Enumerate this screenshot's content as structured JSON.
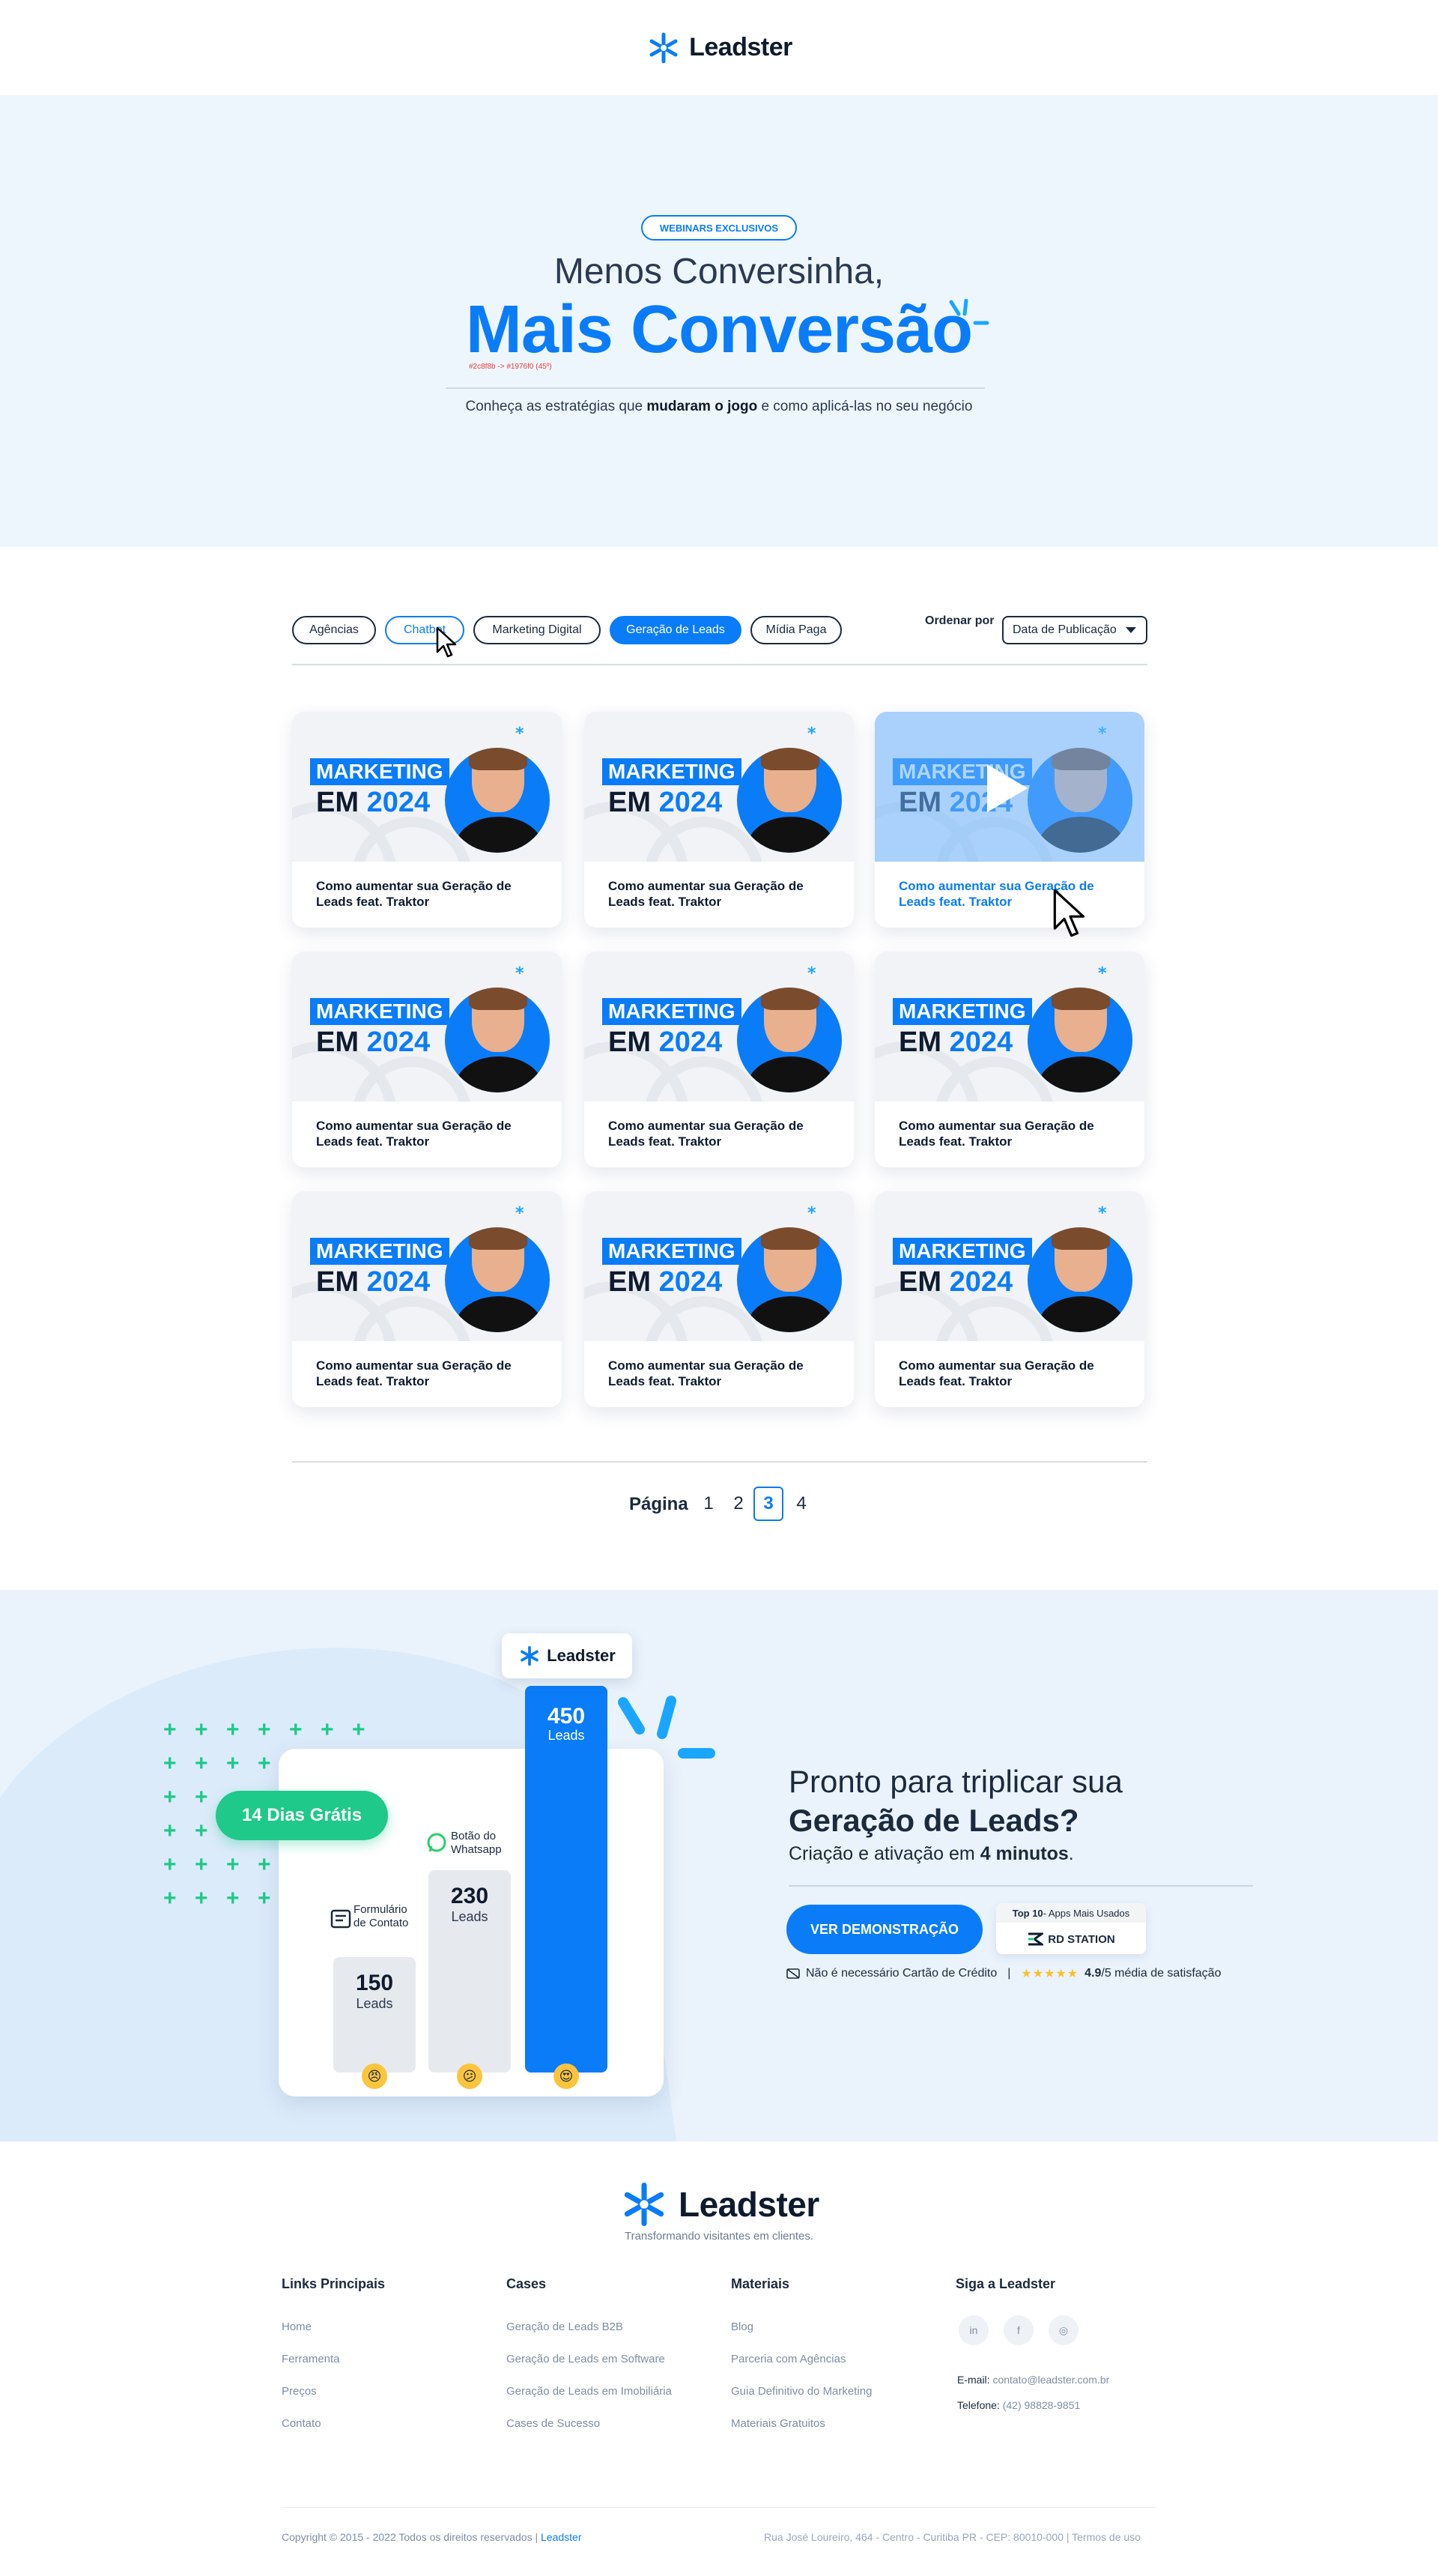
{
  "header": {
    "logo_text": "Leadster"
  },
  "hero": {
    "badge": "WEBINARS EXCLUSIVOS",
    "line1": "Menos Conversinha,",
    "line2": "Mais Conversão",
    "tiny_note": "#2c8f8b -> #1976f0 (45º)",
    "subtitle_pre": "Conheça as estratégias que ",
    "subtitle_bold": "mudaram o jogo",
    "subtitle_post": " e como aplicá-las no seu negócio"
  },
  "filters": {
    "items": [
      {
        "label": "Agências",
        "state": "default"
      },
      {
        "label": "Chatbot",
        "state": "hover"
      },
      {
        "label": "Marketing Digital",
        "state": "default"
      },
      {
        "label": "Geração de Leads",
        "state": "active"
      },
      {
        "label": "Mídia Paga",
        "state": "default"
      }
    ],
    "sort_label": "Ordenar por",
    "sort_value": "Data de Publicação"
  },
  "cards": [
    {
      "title": "Como aumentar sua Geração de Leads feat. Traktor",
      "thumb_l1": "MARKETING",
      "thumb_l2a": "EM ",
      "thumb_l2b": "2024"
    },
    {
      "title": "Como aumentar sua Geração de Leads feat. Traktor",
      "thumb_l1": "MARKETING",
      "thumb_l2a": "EM ",
      "thumb_l2b": "2024"
    },
    {
      "title": "Como aumentar sua Geração de Leads feat. Traktor",
      "thumb_l1": "MARKETING",
      "thumb_l2a": "EM ",
      "thumb_l2b": "2024",
      "hovered": true
    },
    {
      "title": "Como aumentar sua Geração de Leads feat. Traktor",
      "thumb_l1": "MARKETING",
      "thumb_l2a": "EM ",
      "thumb_l2b": "2024"
    },
    {
      "title": "Como aumentar sua Geração de Leads feat. Traktor",
      "thumb_l1": "MARKETING",
      "thumb_l2a": "EM ",
      "thumb_l2b": "2024"
    },
    {
      "title": "Como aumentar sua Geração de Leads feat. Traktor",
      "thumb_l1": "MARKETING",
      "thumb_l2a": "EM ",
      "thumb_l2b": "2024"
    },
    {
      "title": "Como aumentar sua Geração de Leads feat. Traktor",
      "thumb_l1": "MARKETING",
      "thumb_l2a": "EM ",
      "thumb_l2b": "2024"
    },
    {
      "title": "Como aumentar sua Geração de Leads feat. Traktor",
      "thumb_l1": "MARKETING",
      "thumb_l2a": "EM ",
      "thumb_l2b": "2024"
    },
    {
      "title": "Como aumentar sua Geração de Leads feat. Traktor",
      "thumb_l1": "MARKETING",
      "thumb_l2a": "EM ",
      "thumb_l2b": "2024"
    }
  ],
  "pagination": {
    "label": "Página",
    "pages": [
      "1",
      "2",
      "3",
      "4"
    ],
    "current": "3"
  },
  "cta": {
    "chip_text": "Leadster",
    "badge": "14 Dias Grátis",
    "bars": [
      {
        "value": "150",
        "unit": "Leads",
        "label": "Formulário de Contato",
        "emoji": "angry"
      },
      {
        "value": "230",
        "unit": "Leads",
        "label": "Botão do Whatsapp",
        "emoji": "confused"
      },
      {
        "value": "450",
        "unit": "Leads",
        "label": "",
        "emoji": "heart-eyes"
      }
    ],
    "title_l1": "Pronto para triplicar sua",
    "title_l2": "Geração de Leads?",
    "sub_pre": "Criação e ativação em ",
    "sub_bold": "4 minutos",
    "sub_post": ".",
    "button": "VER DEMONSTRAÇÃO",
    "rd_top_bold": "Top 10",
    "rd_top_rest": " - Apps Mais Usados",
    "rd_logo": "RD STATION",
    "no_card": "Não é necessário Cartão de Crédito",
    "separator": "|",
    "rating_bold": "4.9",
    "rating_rest": "/5 média de satisfação"
  },
  "footer": {
    "logo_text": "Leadster",
    "tagline": "Transformando visitantes em clientes.",
    "cols": [
      {
        "head": "Links Principais",
        "links": [
          "Home",
          "Ferramenta",
          "Preços",
          "Contato"
        ]
      },
      {
        "head": "Cases",
        "links": [
          "Geração de Leads B2B",
          "Geração de Leads em Software",
          "Geração de Leads em Imobiliária",
          "Cases de Sucesso"
        ]
      },
      {
        "head": "Materiais",
        "links": [
          "Blog",
          "Parceria com Agências",
          "Guia Definitivo do Marketing",
          "Materiais Gratuitos"
        ]
      }
    ],
    "social_head": "Siga a Leadster",
    "social": [
      "in",
      "f",
      "◎"
    ],
    "email_label": "E-mail: ",
    "email": "contato@leadster.com.br",
    "phone_label": "Telefone: ",
    "phone": "(42) 98828-9851",
    "copyright": "Copyright © 2015 - 2022 Todos os direitos reservados | ",
    "copyright_link": "Leadster",
    "address": "Rua José Loureiro, 464 - Centro - Curitiba PR - CEP: 80010-000 | Termos de uso"
  },
  "colors": {
    "brand_blue": "#0a7cf8",
    "green": "#1ec98a",
    "hero_bg": "#eef6fd",
    "dark": "#1b2a3d"
  }
}
